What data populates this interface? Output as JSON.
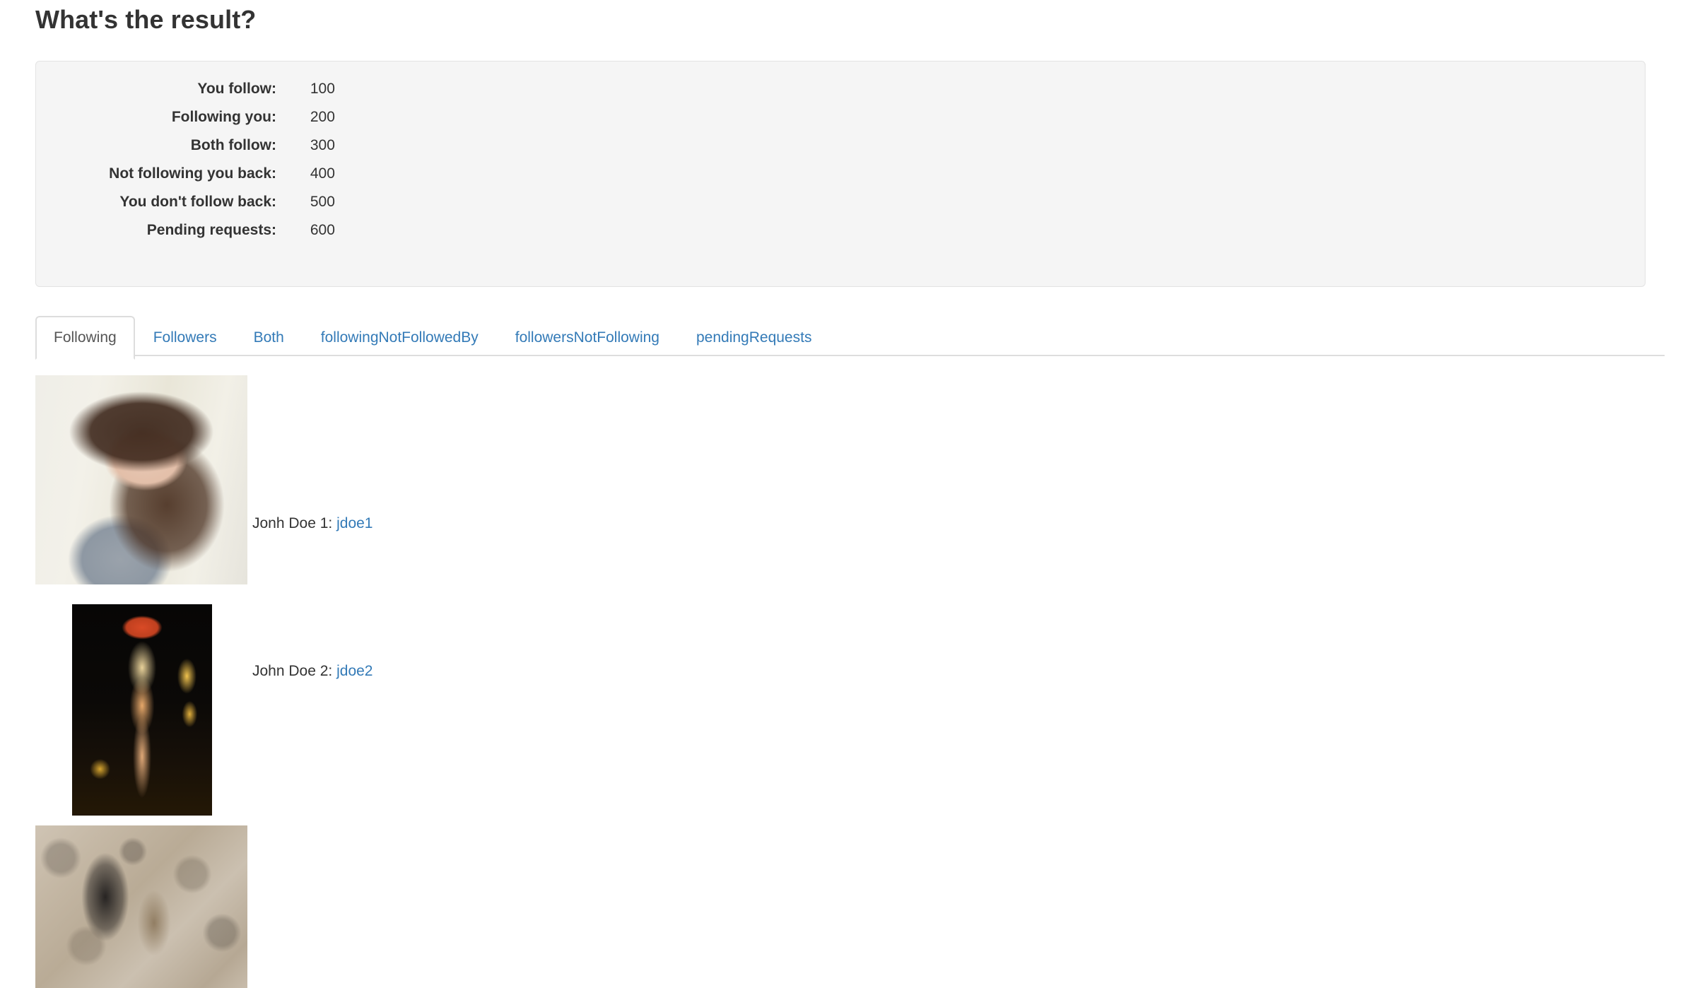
{
  "page": {
    "title": "What's the result?"
  },
  "stats": {
    "rows": [
      {
        "label": "You follow:",
        "value": "100"
      },
      {
        "label": "Following you:",
        "value": "200"
      },
      {
        "label": "Both follow:",
        "value": "300"
      },
      {
        "label": "Not following you back:",
        "value": "400"
      },
      {
        "label": "You don't follow back:",
        "value": "500"
      },
      {
        "label": "Pending requests:",
        "value": "600"
      }
    ]
  },
  "tabs": {
    "active_index": 0,
    "items": [
      {
        "label": "Following"
      },
      {
        "label": "Followers"
      },
      {
        "label": "Both"
      },
      {
        "label": "followingNotFollowedBy"
      },
      {
        "label": "followersNotFollowing"
      },
      {
        "label": "pendingRequests"
      }
    ]
  },
  "users": {
    "items": [
      {
        "name": "Jonh Doe 1: ",
        "handle": "jdoe1",
        "photo": "woman-portrait-photo"
      },
      {
        "name": "John Doe 2: ",
        "handle": "jdoe2",
        "photo": "runway-model-photo"
      },
      {
        "name": "",
        "handle": "",
        "photo": "rock-texture-photo"
      }
    ]
  },
  "colors": {
    "link": "#337ab7",
    "text": "#333333",
    "panel_bg": "#f5f5f5",
    "panel_border": "#e3e3e3",
    "tab_border": "#dddddd",
    "active_tab_text": "#555555"
  }
}
